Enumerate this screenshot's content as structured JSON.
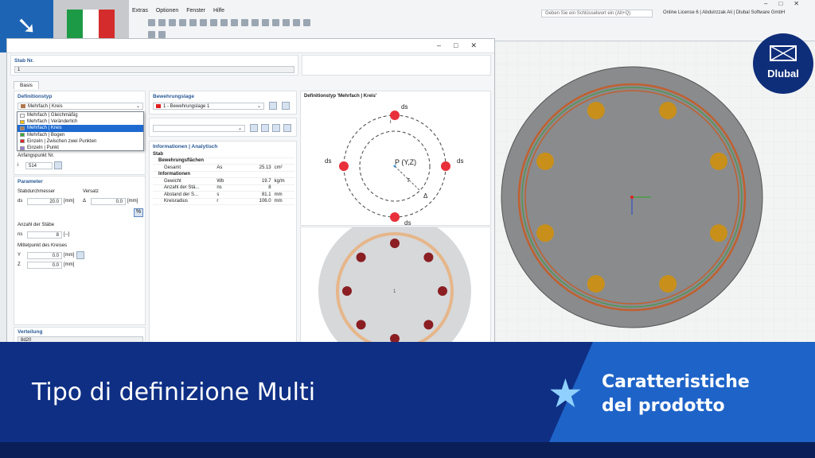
{
  "menu": {
    "items": [
      "Extras",
      "Optionen",
      "Fenster",
      "Hilfe"
    ]
  },
  "search": {
    "placeholder": "Geben Sie ein Schlüsselwort ein (Alt+Q)"
  },
  "license": "Online License 6 | Abdulrzzak Ali | Dlubal Software GmbH",
  "logo": {
    "text": "Dlubal"
  },
  "dialog": {
    "member_label": "Stab Nr.",
    "member_value": "1",
    "tab_basis": "Basis",
    "deftype_label": "Definitionstyp",
    "deftype_value": "Mehrfach | Kreis",
    "dropdown_items": [
      {
        "label": "Mehrfach | Gleichmäßig",
        "color": "#ffffff"
      },
      {
        "label": "Mehrfach | Veränderlich",
        "color": "#f5c400"
      },
      {
        "label": "Mehrfach | Kreis",
        "color": "#b07850"
      },
      {
        "label": "Mehrfach | Bogen",
        "color": "#3aa838"
      },
      {
        "label": "Einzeln | Zwischen zwei Punkten",
        "color": "#e02020"
      },
      {
        "label": "Einzeln | Punkt",
        "color": "#9a7ad8"
      }
    ],
    "start_point_label": "Anfangspunkt Nr.",
    "start_point_sub": "i",
    "start_point_value": "514",
    "param_label": "Parameter",
    "diameter_label": "Stabdurchmesser",
    "diameter_sym": "ds",
    "diameter_value": "20.0",
    "diameter_unit": "[mm]",
    "offset_label": "Versatz",
    "offset_sym": "Δ",
    "offset_value": "0.0",
    "offset_unit": "[mm]",
    "count_label": "Anzahl der Stäbe",
    "count_sym": "ns",
    "count_value": "8",
    "count_unit": "[--]",
    "center_label": "Mittelpunkt des Kreises",
    "y_sym": "Y",
    "y_value": "0.0",
    "y_unit": "[mm]",
    "z_sym": "Z",
    "z_value": "0.0",
    "z_unit": "[mm]",
    "distribution_label": "Verteilung",
    "distribution_value": "8d20",
    "layer_label": "Bewehrungslage",
    "layer_value": "1 - Bewehrungslage 1",
    "info_label": "Informationen | Analytisch",
    "tree": [
      {
        "indent": 0,
        "name": "Stab",
        "sym": "",
        "val": "",
        "unit": ""
      },
      {
        "indent": 1,
        "name": "Bewehrungsflächen",
        "sym": "",
        "val": "",
        "unit": ""
      },
      {
        "indent": 2,
        "name": "Gesamt",
        "sym": "As",
        "val": "25.13",
        "unit": "cm²"
      },
      {
        "indent": 1,
        "name": "Informationen",
        "sym": "",
        "val": "",
        "unit": ""
      },
      {
        "indent": 2,
        "name": "Gewicht",
        "sym": "Wb",
        "val": "19.7",
        "unit": "kg/m"
      },
      {
        "indent": 2,
        "name": "Anzahl der Stä...",
        "sym": "ns",
        "val": "8",
        "unit": ""
      },
      {
        "indent": 2,
        "name": "Abstand der S...",
        "sym": "s",
        "val": "81.1",
        "unit": "mm"
      },
      {
        "indent": 2,
        "name": "Kreisradius",
        "sym": "r",
        "val": "106.0",
        "unit": "mm"
      }
    ],
    "preview_title": "Definitionstyp 'Mehrfach | Kreis'",
    "diagram": {
      "ds": "ds",
      "center": "P (Y,Z)",
      "r": "r",
      "delta": "Δ",
      "i": "i"
    },
    "section_label": "1"
  },
  "banner": {
    "title": "Tipo di definizione Multi",
    "subtitle_line1": "Caratteristiche",
    "subtitle_line2": "del prodotto"
  },
  "colors": {
    "banner": "#0e2f84",
    "accent": "#1e63c8",
    "bar_red": "#e8303a",
    "bar_gold": "#c8901a"
  }
}
